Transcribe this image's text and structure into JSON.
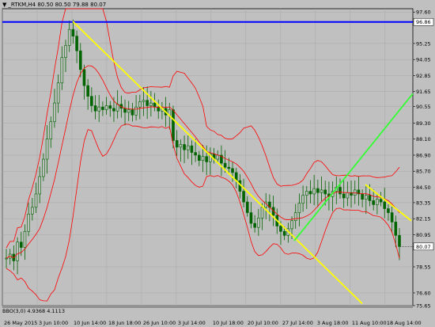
{
  "header": {
    "symbol_line": "_RTKM,H4  80.50 80.50 79.88 80.07",
    "dropdown_icon": "triangle-down-icon"
  },
  "indicator": {
    "label": "BBO(3,0) 4.9368 4.1113"
  },
  "colors": {
    "background": "#c0c0c0",
    "grid": "#a8a8a8",
    "candle": "#006400",
    "bands": "#ff0000",
    "hline": "#0000ff",
    "trend_yellow": "#ffff00",
    "trend_green": "#33ff33",
    "price_label_bg": "#ffffff"
  },
  "chart_data": {
    "type": "candlestick",
    "title": "",
    "ylim": [
      75.65,
      98.0
    ],
    "y_ticks": [
      "97.60",
      "96.86",
      "95.25",
      "94.05",
      "92.85",
      "91.65",
      "90.55",
      "89.30",
      "88.10",
      "86.90",
      "85.70",
      "84.50",
      "83.35",
      "82.15",
      "80.95",
      "80.07",
      "78.55",
      "76.60",
      "75.65"
    ],
    "x_ticks": [
      "26 May 2015",
      "3 Jun 10:00",
      "10 Jun 14:00",
      "18 Jun 18:00",
      "26 Jun 10:00",
      "3 Jul 14:00",
      "10 Jul 18:00",
      "20 Jul 10:00",
      "27 Jul 14:00",
      "3 Aug 18:00",
      "11 Aug 10:00",
      "18 Aug 14:00"
    ],
    "horizontal_line": 96.86,
    "last_price": 80.07,
    "trendlines": [
      {
        "color": "yellow",
        "from_x": "10 Jun 14:00",
        "from_y": 96.9,
        "to_x": "18 Aug 14:00",
        "to_y": 75.8
      },
      {
        "color": "yellow",
        "from_x": "11 Aug 10:00",
        "from_y": 84.7,
        "to_x": "18 Aug 14:00",
        "to_y": 82.0
      },
      {
        "color": "green",
        "from_x": "27 Jul 14:00",
        "from_y": 80.5,
        "to_x": "18 Aug 14:00",
        "to_y": 91.5
      }
    ],
    "close_path": [
      79.2,
      79.5,
      79.0,
      80.4,
      80.0,
      81.2,
      82.5,
      83.0,
      84.0,
      85.3,
      86.6,
      88.1,
      89.4,
      90.8,
      92.3,
      94.2,
      95.1,
      96.3,
      95.8,
      94.7,
      93.3,
      92.1,
      91.3,
      90.6,
      90.2,
      90.5,
      90.3,
      90.6,
      90.4,
      90.2,
      90.7,
      90.4,
      90.1,
      90.3,
      89.9,
      90.5,
      90.9,
      91.0,
      90.6,
      90.8,
      90.5,
      90.2,
      90.4,
      89.9,
      90.3,
      88.0,
      87.5,
      87.7,
      87.3,
      87.6,
      87.1,
      86.9,
      86.5,
      86.8,
      86.4,
      87.0,
      86.6,
      86.9,
      86.3,
      86.0,
      85.9,
      85.6,
      85.0,
      84.2,
      83.4,
      82.6,
      81.8,
      81.5,
      82.2,
      83.0,
      83.4,
      83.0,
      82.4,
      81.6,
      81.2,
      80.9,
      81.4,
      82.0,
      82.6,
      83.3,
      83.9,
      84.2,
      84.0,
      84.4,
      84.1,
      84.3,
      84.0,
      83.8,
      84.2,
      84.5,
      84.0,
      83.7,
      84.1,
      83.9,
      84.3,
      84.0,
      83.6,
      83.9,
      83.5,
      83.2,
      83.6,
      83.4,
      82.9,
      82.6,
      81.9,
      80.9,
      80.07
    ]
  }
}
